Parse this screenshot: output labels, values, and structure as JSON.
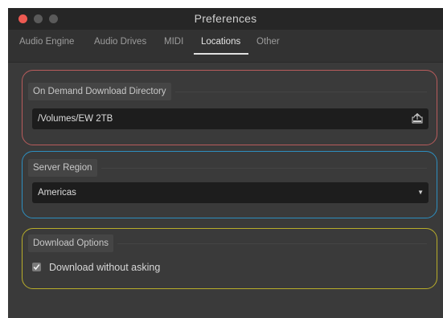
{
  "window": {
    "title": "Preferences"
  },
  "tabs": [
    {
      "label": "Audio Engine"
    },
    {
      "label": "Audio Drives"
    },
    {
      "label": "MIDI"
    },
    {
      "label": "Locations"
    },
    {
      "label": "Other"
    }
  ],
  "active_tab": "Locations",
  "download_directory": {
    "label": "On Demand Download Directory",
    "value": "/Volumes/EW 2TB",
    "icon": "folder-icon"
  },
  "server_region": {
    "label": "Server Region",
    "selected": "Americas",
    "icon": "chevron-down-icon"
  },
  "download_options": {
    "label": "Download Options",
    "download_without_asking": {
      "label": "Download without asking",
      "checked": true
    }
  },
  "colors": {
    "highlight_red": "#b85c5c",
    "highlight_blue": "#2d8fc0",
    "highlight_yellow": "#b8ad2a",
    "close_button": "#ee5a52"
  }
}
